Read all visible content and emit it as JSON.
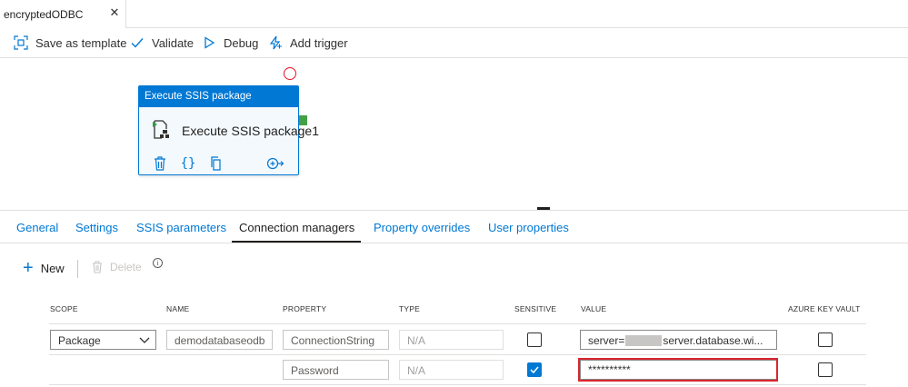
{
  "document_tab": {
    "title": "encryptedODBC",
    "close_glyph": "✕"
  },
  "toolbar": {
    "save_template": "Save as template",
    "validate": "Validate",
    "debug": "Debug",
    "add_trigger": "Add trigger"
  },
  "activity": {
    "header": "Execute SSIS package",
    "name": "Execute SSIS package1",
    "icons": [
      "delete-icon",
      "code-icon",
      "copy-icon",
      "add-output-icon"
    ]
  },
  "property_tabs": [
    {
      "label": "General"
    },
    {
      "label": "Settings"
    },
    {
      "label": "SSIS parameters"
    },
    {
      "label": "Connection managers",
      "active": true
    },
    {
      "label": "Property overrides"
    },
    {
      "label": "User properties"
    }
  ],
  "commands": {
    "new": "New",
    "delete": "Delete",
    "info": "i"
  },
  "grid": {
    "headers": {
      "scope": "SCOPE",
      "name": "NAME",
      "property": "PROPERTY",
      "type": "TYPE",
      "sensitive": "SENSITIVE",
      "value": "VALUE",
      "akv": "AZURE KEY VAULT"
    },
    "rows": [
      {
        "scope": "Package",
        "name": "demodatabaseodb",
        "property": "ConnectionString",
        "type": "N/A",
        "sensitive": false,
        "value_prefix": "server=",
        "value_suffix": "server.database.wi...",
        "azure_key_vault": false
      },
      {
        "property": "Password",
        "type": "N/A",
        "sensitive": true,
        "value": "**********",
        "azure_key_vault": false
      }
    ]
  },
  "colors": {
    "accent": "#0078d4",
    "highlight": "#d9262f",
    "port": "#44a047",
    "error": "#e81123"
  }
}
